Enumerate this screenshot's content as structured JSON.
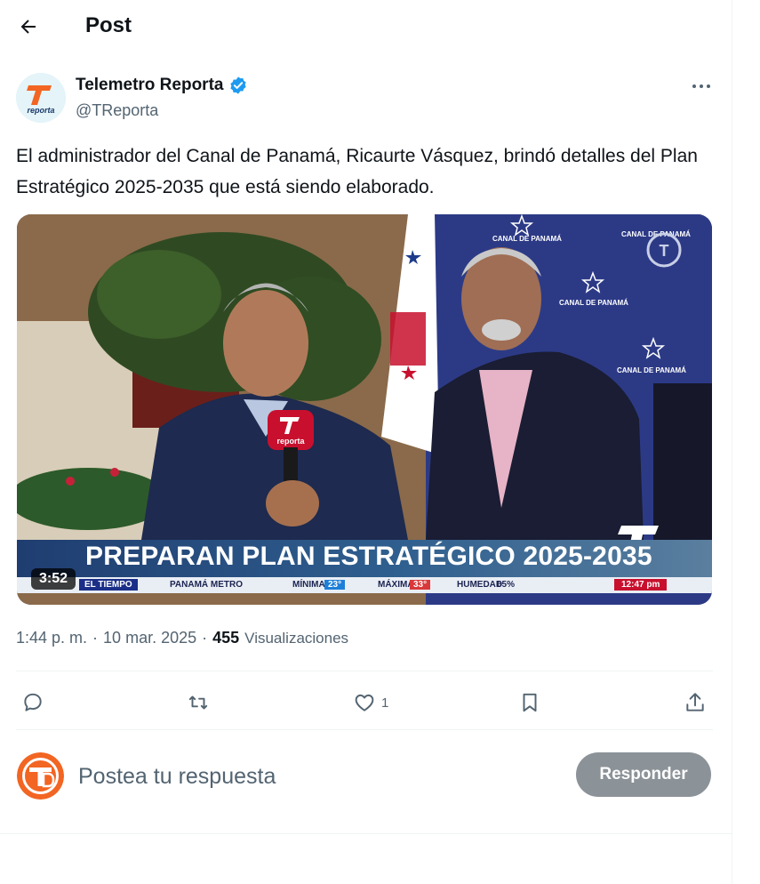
{
  "header": {
    "title": "Post"
  },
  "author": {
    "name": "Telemetro Reporta",
    "handle": "@TReporta",
    "avatar_text": "reporta"
  },
  "post": {
    "text": "El administrador del Canal de Panamá, Ricaurte Vásquez, brindó detalles del Plan Estratégico 2025-2035 que está siendo elaborado.",
    "time": "1:44 p. m.",
    "separator": "·",
    "date": "10 mar. 2025",
    "views_count": "455",
    "views_label": "Visualizaciones"
  },
  "media": {
    "duration": "3:52",
    "lower_third": "PREPARAN PLAN ESTRATÉGICO 2025-2035",
    "backdrop_text": "CANAL DE PANAMÁ",
    "mic_text": "reporta",
    "ticker": {
      "el_tiempo": "EL TIEMPO",
      "city": "PANAMÁ METRO",
      "min_label": "MÍNIMA",
      "min_value": "23°",
      "max_label": "MÁXIMA",
      "max_value": "33°",
      "hum_label": "HUMEDAD",
      "hum_value": "65%",
      "clock": "12:47 pm"
    }
  },
  "actions": {
    "reply_count": "",
    "retweet_count": "",
    "like_count": "1",
    "bookmark_count": "",
    "share_count": ""
  },
  "reply": {
    "placeholder": "Postea tu respuesta",
    "button_label": "Responder"
  },
  "colors": {
    "text": "#0f1419",
    "secondary": "#536471",
    "verified": "#1d9bf0",
    "reply_button": "#8b9298",
    "divider": "#eff3f4",
    "brand_orange": "#f26522"
  }
}
